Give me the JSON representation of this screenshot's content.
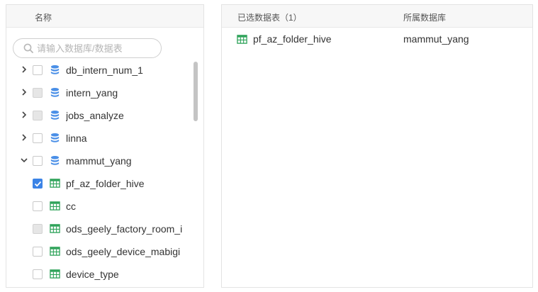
{
  "left_panel": {
    "header_title": "名称",
    "search": {
      "placeholder": "请输入数据库/数据表"
    },
    "items": [
      {
        "label": "db_intern_num_1",
        "type": "database",
        "expander": "collapsed",
        "checkbox": "unchecked"
      },
      {
        "label": "intern_yang",
        "type": "database",
        "expander": "collapsed",
        "checkbox": "disabled"
      },
      {
        "label": "jobs_analyze",
        "type": "database",
        "expander": "collapsed",
        "checkbox": "disabled"
      },
      {
        "label": "linna",
        "type": "database",
        "expander": "collapsed",
        "checkbox": "unchecked"
      },
      {
        "label": "mammut_yang",
        "type": "database",
        "expander": "expanded",
        "checkbox": "unchecked"
      },
      {
        "label": "pf_az_folder_hive",
        "type": "table",
        "checkbox": "checked"
      },
      {
        "label": "cc",
        "type": "table",
        "checkbox": "unchecked"
      },
      {
        "label": "ods_geely_factory_room_i",
        "type": "table",
        "checkbox": "disabled"
      },
      {
        "label": "ods_geely_device_mabigi",
        "type": "table",
        "checkbox": "unchecked"
      },
      {
        "label": "device_type",
        "type": "table",
        "checkbox": "unchecked"
      }
    ]
  },
  "right_panel": {
    "header_selected": "已选数据表（1）",
    "header_database": "所属数据库",
    "selected": [
      {
        "table": "pf_az_folder_hive",
        "database": "mammut_yang"
      }
    ]
  },
  "icons": {
    "database": "database-icon",
    "table": "table-grid-icon",
    "search": "search-icon",
    "expand": "chevron-right-icon",
    "collapse": "chevron-down-icon"
  },
  "colors": {
    "database_icon": "#4a8fe7",
    "table_icon": "#2fa35a",
    "checkbox_checked": "#3b83e6",
    "checkbox_disabled": "#e6e6e6"
  }
}
